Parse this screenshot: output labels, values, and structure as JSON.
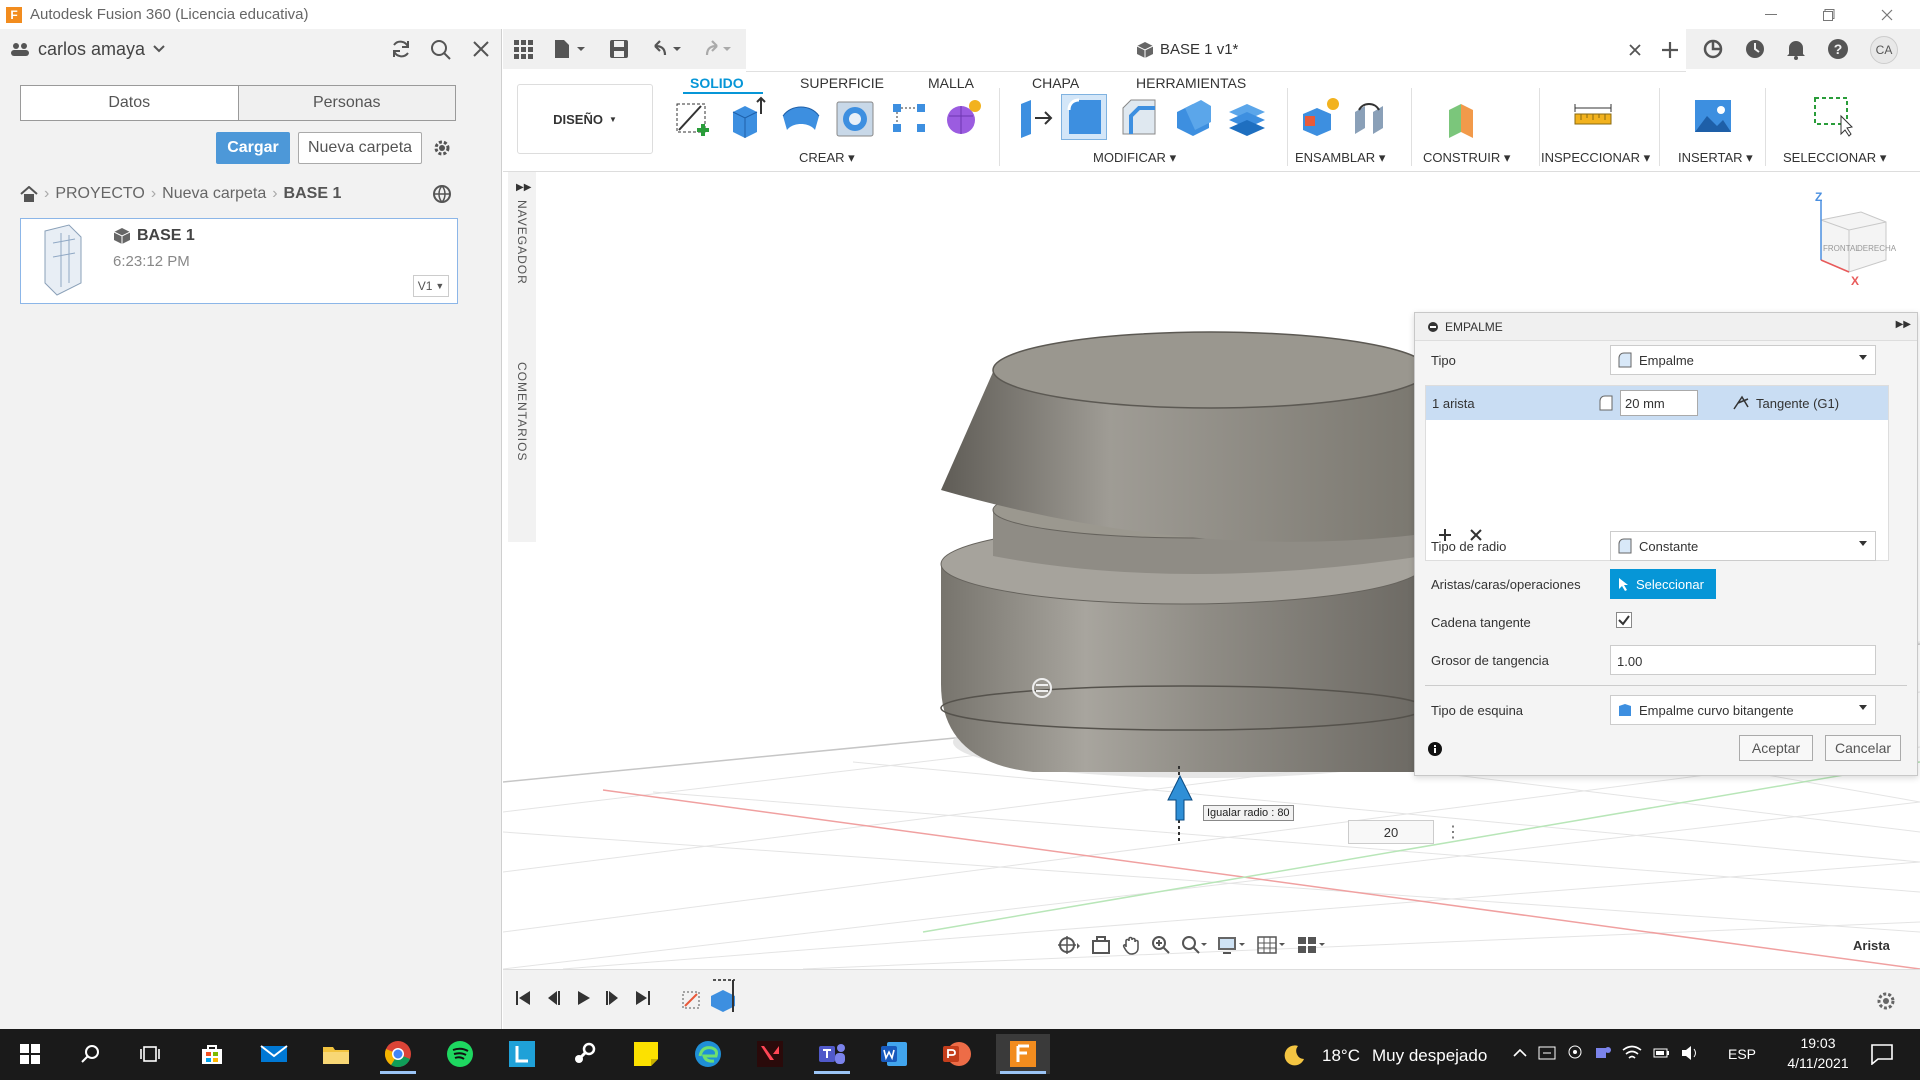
{
  "window": {
    "title": "Autodesk Fusion 360 (Licencia educativa)",
    "app_letter": "F"
  },
  "left_panel": {
    "user": "carlos amaya",
    "tabs": [
      "Datos",
      "Personas"
    ],
    "upload_button": "Cargar",
    "new_folder_button": "Nueva carpeta",
    "breadcrumb": [
      "PROYECTO",
      "Nueva carpeta",
      "BASE 1"
    ],
    "file": {
      "name": "BASE 1",
      "time": "6:23:12 PM",
      "version": "V1"
    }
  },
  "document": {
    "tab_title": "BASE 1 v1*",
    "user_initials": "CA"
  },
  "ribbon": {
    "workspace": "DISEÑO",
    "tabs": [
      "SOLIDO",
      "SUPERFICIE",
      "MALLA",
      "CHAPA",
      "HERRAMIENTAS"
    ],
    "active_tab": "SOLIDO",
    "groups": [
      "CREAR",
      "MODIFICAR",
      "ENSAMBLAR",
      "CONSTRUIR",
      "INSPECCIONAR",
      "INSERTAR",
      "SELECCIONAR"
    ]
  },
  "browser": {
    "navigator": "NAVEGADOR",
    "comments": "COMENTARIOS"
  },
  "viewcube": {
    "top_axis": "Z",
    "x_axis": "X",
    "front": "FRONTAL",
    "right": "DERECHA"
  },
  "fillet_panel": {
    "title": "EMPALME",
    "type_label": "Tipo",
    "type_value": "Empalme",
    "edge_row": {
      "label": "1 arista",
      "radius": "20 mm",
      "continuity": "Tangente (G1)"
    },
    "radius_type_label": "Tipo de radio",
    "radius_type_value": "Constante",
    "selection_label": "Aristas/caras/operaciones",
    "select_button": "Seleccionar",
    "tangent_chain_label": "Cadena tangente",
    "tangent_chain_checked": true,
    "tangency_weight_label": "Grosor de tangencia",
    "tangency_weight_value": "1.00",
    "corner_type_label": "Tipo de esquina",
    "corner_type_value": "Empalme curvo bitangente",
    "ok_button": "Aceptar",
    "cancel_button": "Cancelar"
  },
  "viewport": {
    "tooltip": "Igualar radio : 80",
    "radius_input": "20",
    "selection_status": "Arista"
  },
  "taskbar": {
    "weather_temp": "18°C",
    "weather_text": "Muy despejado",
    "language": "ESP",
    "time": "19:03",
    "date": "4/11/2021"
  },
  "colors": {
    "accent": "#0696d7",
    "select_blue": "#3a8fd8",
    "taskbar": "#1a1a1a",
    "body_gray": "#8a8780"
  }
}
